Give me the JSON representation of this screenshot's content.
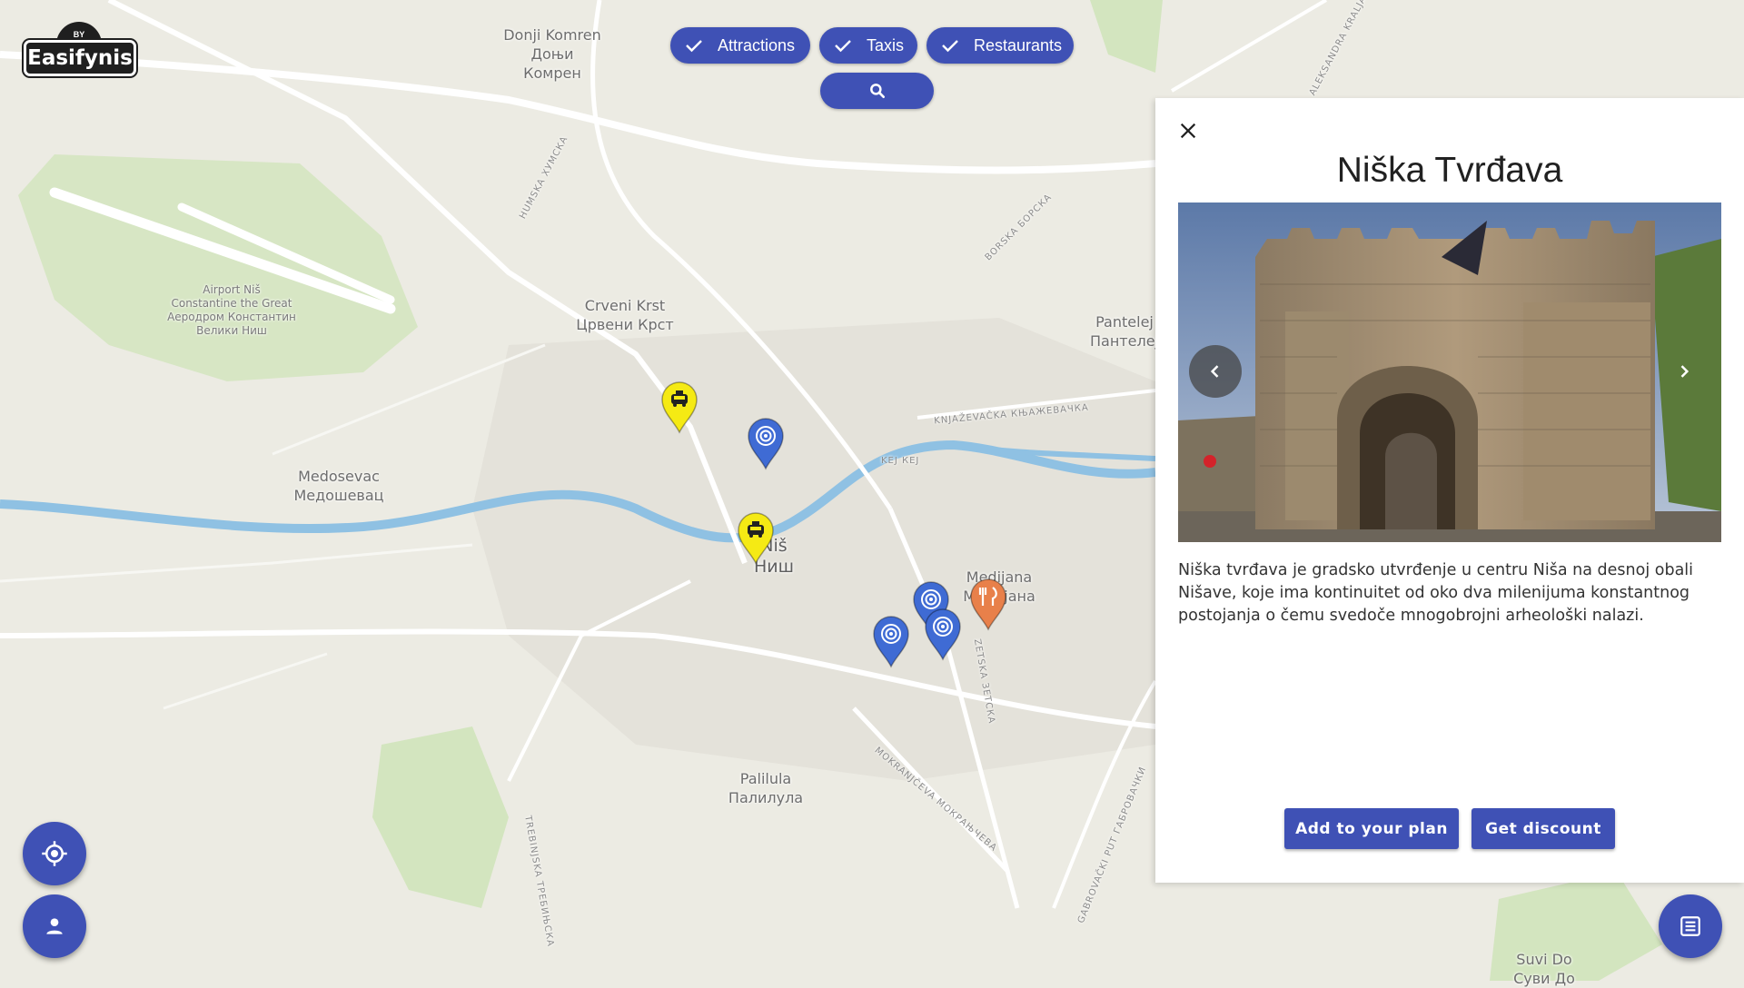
{
  "app": {
    "logo_text": "Easifynis",
    "logo_badge": "BY"
  },
  "filters": [
    {
      "label": "Attractions",
      "checked": true
    },
    {
      "label": "Taxis",
      "checked": true
    },
    {
      "label": "Restaurants",
      "checked": true
    }
  ],
  "search": {
    "icon": "search-icon"
  },
  "map": {
    "places": [
      "Donji Komren\nДоњи\nКомрен",
      "Crveni Krst\nЦрвени Крст",
      "Pantelej\nПантелеј",
      "Medosevac\nМедошевац",
      "Niš\nНиш",
      "Medijana\nМедијана",
      "Palilula\nПалилула",
      "Suvi Do\nСуви До"
    ],
    "airport": "Airport Niš\nConstantine the Great\nАеродром Константин\nВелики Ниш",
    "streets": [
      "HUMSKA ХУМСКА",
      "BORSKA БОРСКА",
      "KNJAŽEVAČKA КЊАЖЕВАЧКА",
      "KEJ КЕЈ",
      "MOKRANJČEVA МОКРАЊЧЕВА",
      "TREBINJSKA ТРЕБИЊСКА",
      "GABROVAČKI PUT ГАБРОВАЧКИ",
      "ALEKSANDRA KRALJA",
      "ZETSKA ЗЕТСКА"
    ],
    "markers": [
      {
        "type": "taxi",
        "icon": "taxi-icon"
      },
      {
        "type": "attraction",
        "icon": "attraction-icon"
      },
      {
        "type": "taxi",
        "icon": "taxi-icon"
      },
      {
        "type": "attraction",
        "icon": "attraction-icon"
      },
      {
        "type": "attraction",
        "icon": "attraction-icon"
      },
      {
        "type": "attraction",
        "icon": "attraction-icon"
      },
      {
        "type": "restaurant",
        "icon": "restaurant-icon"
      }
    ],
    "colors": {
      "water": "#8fc1e3",
      "park": "#cfe3b4",
      "taxi": "#f5ea14",
      "attraction": "#3f6bd4",
      "restaurant": "#e8804a",
      "accent": "#3f51b5"
    }
  },
  "panel": {
    "title": "Niška Tvrđava",
    "description": "Niška tvrđava je gradsko utvrđenje u centru Niša na desnoj obali Nišave, koje ima kontinuitet od oko dva milenijuma konstantnog postojanja o čemu svedoče mnogobrojni arheološki nalazi.",
    "add_label": "Add to your plan",
    "discount_label": "Get discount",
    "close_icon": "close-icon",
    "image_caption": "Nisava fortress gate"
  },
  "fabs": {
    "locate": "crosshair-icon",
    "profile": "person-icon",
    "list": "list-icon"
  }
}
